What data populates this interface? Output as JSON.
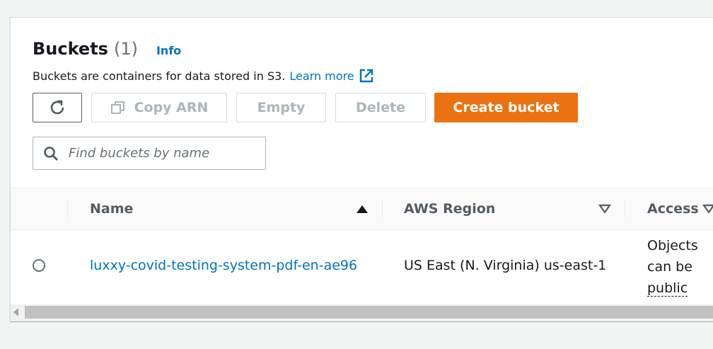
{
  "header": {
    "title": "Buckets",
    "count": "(1)",
    "info_label": "Info"
  },
  "description": {
    "text": "Buckets are containers for data stored in S3.",
    "learn_more": "Learn more"
  },
  "toolbar": {
    "refresh_icon": "refresh-icon",
    "copy_arn_label": "Copy ARN",
    "empty_label": "Empty",
    "delete_label": "Delete",
    "create_label": "Create bucket"
  },
  "search": {
    "placeholder": "Find buckets by name",
    "value": ""
  },
  "table": {
    "columns": [
      "Name",
      "AWS Region",
      "Access"
    ],
    "rows": [
      {
        "name": "luxxy-covid-testing-system-pdf-en-ae96",
        "region": "US East (N. Virginia) us-east-1",
        "access_line1": "Objects",
        "access_line2": "can be",
        "access_line3": "public"
      }
    ]
  },
  "colors": {
    "primary": "#ec7211",
    "link": "#0073bb",
    "disabled_text": "#aab7b8"
  }
}
